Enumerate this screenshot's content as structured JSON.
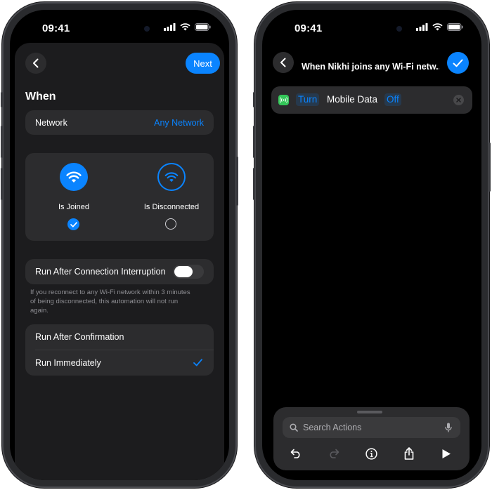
{
  "left_phone": {
    "status_time": "09:41",
    "next_label": "Next",
    "section_title": "When",
    "network_row": {
      "label": "Network",
      "value": "Any Network"
    },
    "options": [
      {
        "label": "Is Joined",
        "selected": true
      },
      {
        "label": "Is Disconnected",
        "selected": false
      }
    ],
    "interruption_row": {
      "label": "Run After Connection Interruption",
      "toggle_on": false
    },
    "footnote": "If you reconnect to any Wi-Fi network within 3 minutes of being disconnected, this automation will not run again.",
    "run_options": [
      {
        "label": "Run After Confirmation",
        "checked": false
      },
      {
        "label": "Run Immediately",
        "checked": true
      }
    ]
  },
  "right_phone": {
    "status_time": "09:41",
    "title": "When Nikhi joins any Wi-Fi netw...",
    "action": {
      "verb": "Turn",
      "setting": "Mobile Data",
      "state": "Off"
    },
    "search_placeholder": "Search Actions"
  },
  "colors": {
    "accent": "#0a84ff",
    "card": "#2c2c2e",
    "sheet": "#1c1c1e",
    "app_icon": "#34c759"
  }
}
